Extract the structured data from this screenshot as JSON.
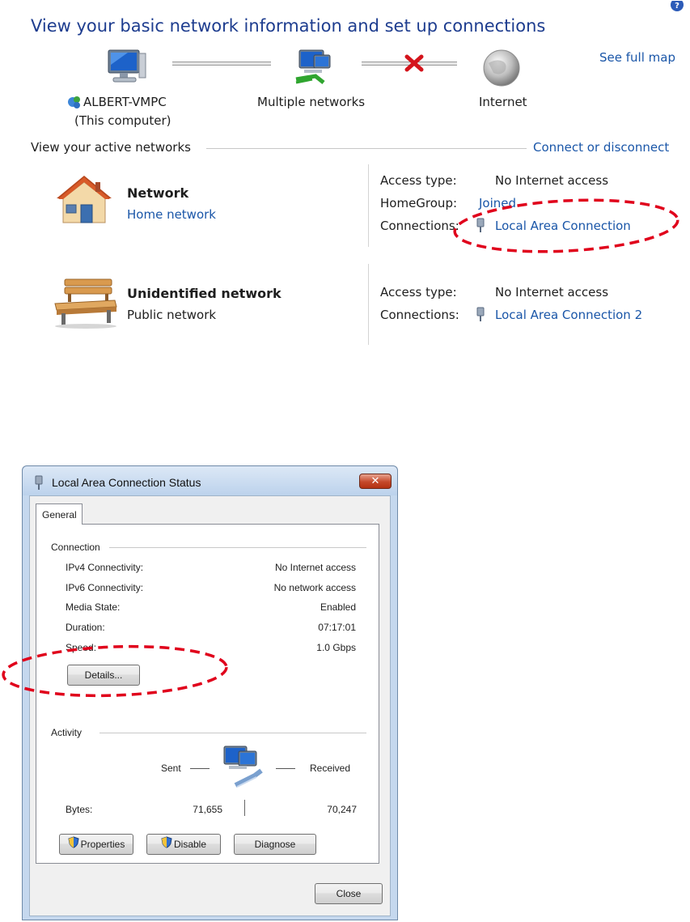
{
  "header": {
    "title": "View your basic network information and set up connections",
    "see_full_map": "See full map"
  },
  "map": {
    "computer_name": "ALBERT-VMPC",
    "computer_sub": "(This computer)",
    "middle_label": "Multiple networks",
    "internet_label": "Internet"
  },
  "active": {
    "section_label": "View your active networks",
    "connect_link": "Connect or disconnect",
    "networks": [
      {
        "name": "Network",
        "type": "Home network",
        "access_label": "Access type:",
        "access_value": "No Internet access",
        "homegroup_label": "HomeGroup:",
        "homegroup_value": "Joined",
        "connections_label": "Connections:",
        "connection": "Local Area Connection"
      },
      {
        "name": "Unidentified network",
        "type": "Public network",
        "access_label": "Access type:",
        "access_value": "No Internet access",
        "connections_label": "Connections:",
        "connection": "Local Area Connection 2"
      }
    ]
  },
  "dialog": {
    "title": "Local Area Connection Status",
    "tab": "General",
    "connection_group": "Connection",
    "rows": [
      {
        "label": "IPv4 Connectivity:",
        "value": "No Internet access"
      },
      {
        "label": "IPv6 Connectivity:",
        "value": "No network access"
      },
      {
        "label": "Media State:",
        "value": "Enabled"
      },
      {
        "label": "Duration:",
        "value": "07:17:01"
      },
      {
        "label": "Speed:",
        "value": "1.0 Gbps"
      }
    ],
    "details_button": "Details...",
    "activity_group": "Activity",
    "sent_label": "Sent",
    "received_label": "Received",
    "bytes_label": "Bytes:",
    "bytes_sent": "71,655",
    "bytes_received": "70,247",
    "properties_button": "Properties",
    "disable_button": "Disable",
    "diagnose_button": "Diagnose",
    "close_button": "Close"
  },
  "colors": {
    "title_blue": "#1e3d8f",
    "link_blue": "#1a56a8",
    "highlight_red": "#e0001b"
  }
}
